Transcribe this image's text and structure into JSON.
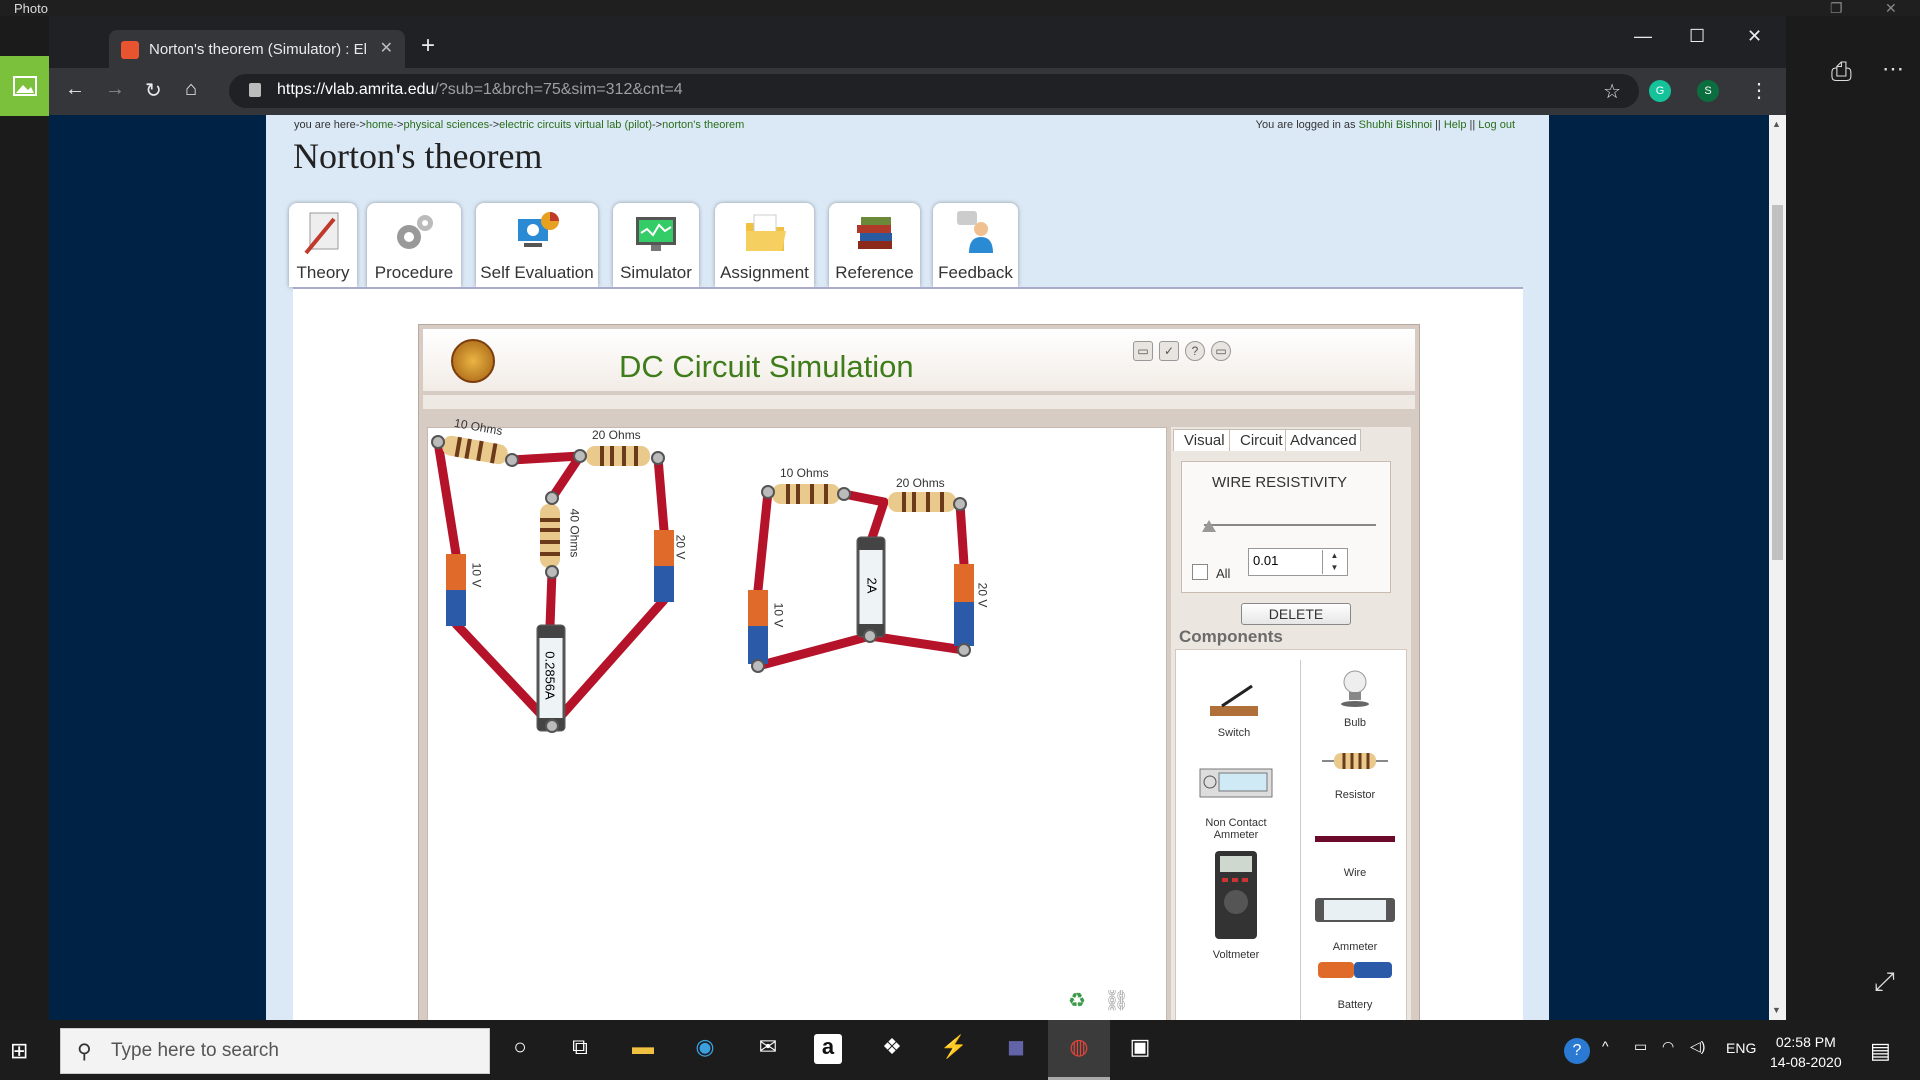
{
  "photos_app": {
    "title": "Photo"
  },
  "browser": {
    "tab_title": "Norton's theorem (Simulator) : El",
    "url_host": "https://vlab.amrita.edu",
    "url_path": "/?sub=1&brch=75&sim=312&cnt=4",
    "profile_initial": "S",
    "grammarly_initial": "G"
  },
  "page": {
    "breadcrumb_prefix": "you are here->",
    "breadcrumb_links": [
      "home",
      "physical sciences",
      "electric circuits virtual lab (pilot)",
      "norton's theorem"
    ],
    "login_prefix": "You are logged in as",
    "user": "Shubhi Bishnoi",
    "help": "Help",
    "logout": "Log out",
    "title": "Norton's theorem",
    "tabs": [
      "Theory",
      "Procedure",
      "Self Evaluation",
      "Simulator",
      "Assignment",
      "Reference",
      "Feedback"
    ]
  },
  "sim": {
    "title": "DC Circuit Simulation",
    "panel_tabs": [
      "Visual",
      "Circuit",
      "Advanced"
    ],
    "wire_resistivity_label": "WIRE RESISTIVITY",
    "wire_resistivity_value": "0.01",
    "slider_level": 0.0,
    "all_label": "All",
    "delete_label": "DELETE",
    "components_title": "Components",
    "components": {
      "switch": "Switch",
      "bulb": "Bulb",
      "resistor": "Resistor",
      "non_contact_ammeter": "Non Contact Ammeter",
      "wire": "Wire",
      "ammeter": "Ammeter",
      "voltmeter": "Voltmeter",
      "battery": "Battery"
    },
    "circuit1": {
      "r1": "10 Ohms",
      "r2": "20 Ohms",
      "r3": "40 Ohms",
      "b1": "10 V",
      "b2": "20 V",
      "ammeter": "0.2856A"
    },
    "circuit2": {
      "r1": "10 Ohms",
      "r2": "20 Ohms",
      "b1": "10 V",
      "b2": "20 V",
      "ammeter": "2A"
    }
  },
  "taskbar": {
    "search_placeholder": "Type here to search",
    "lang": "ENG",
    "time": "02:58 PM",
    "date": "14-08-2020"
  },
  "colors": {
    "sim_title": "#3f7d1a",
    "wire": "#b5132a",
    "page_bg": "#002245"
  }
}
